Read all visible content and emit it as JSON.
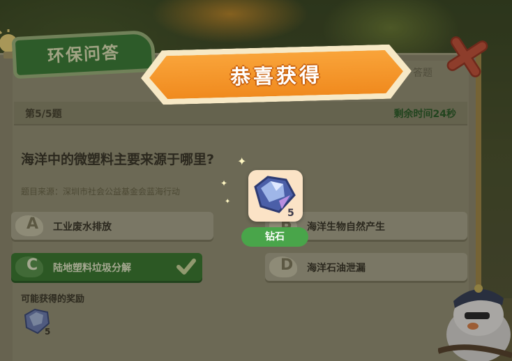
{
  "quiz": {
    "title": "环保问答",
    "answered_label": "答题",
    "progress": "第5/5题",
    "timer": "剩余时间24秒",
    "question": "海洋中的微塑料主要来源于哪里?",
    "source": "题目来源：深圳市社会公益基金会蓝海行动",
    "options": [
      {
        "letter": "A",
        "text": "工业废水排放"
      },
      {
        "letter": "B",
        "text": "海洋生物自然产生"
      },
      {
        "letter": "C",
        "text": "陆地塑料垃圾分解"
      },
      {
        "letter": "D",
        "text": "海洋石油泄漏"
      }
    ],
    "correct_option": "C",
    "reward_label": "可能获得的奖励",
    "reward_count": "5"
  },
  "popup": {
    "banner": "恭喜获得",
    "item_name": "钻石",
    "item_count": "5"
  },
  "colors": {
    "accent_orange": "#f08a1e",
    "correct_green": "#3e7a33",
    "close_red": "#e0533a"
  },
  "icons": {
    "bulb": "lightbulb-icon",
    "close": "close-icon",
    "check": "check-icon",
    "diamond": "diamond-icon",
    "mascot": "mascot-bird"
  }
}
